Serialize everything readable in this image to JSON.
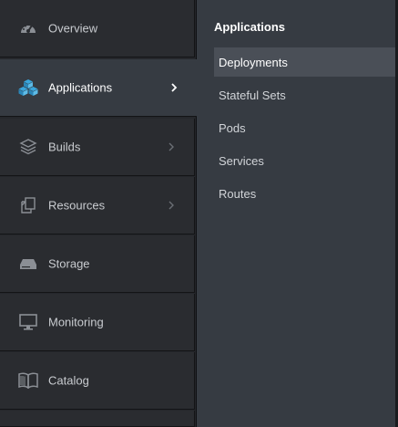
{
  "nav": {
    "items": [
      {
        "label": "Overview",
        "icon": "dashboard-gauge-icon",
        "has_submenu": false
      },
      {
        "label": "Applications",
        "icon": "cubes-icon",
        "has_submenu": true,
        "active": true
      },
      {
        "label": "Builds",
        "icon": "layers-icon",
        "has_submenu": true
      },
      {
        "label": "Resources",
        "icon": "files-icon",
        "has_submenu": true
      },
      {
        "label": "Storage",
        "icon": "hard-drive-icon",
        "has_submenu": false
      },
      {
        "label": "Monitoring",
        "icon": "monitor-icon",
        "has_submenu": false
      },
      {
        "label": "Catalog",
        "icon": "book-icon",
        "has_submenu": false
      }
    ]
  },
  "submenu": {
    "title": "Applications",
    "items": [
      {
        "label": "Deployments",
        "selected": true
      },
      {
        "label": "Stateful Sets"
      },
      {
        "label": "Pods"
      },
      {
        "label": "Services"
      },
      {
        "label": "Routes"
      }
    ]
  },
  "colors": {
    "accent_blue": "#39a5dc",
    "sidebar_bg": "#2a2c30",
    "active_bg": "#363b42",
    "selected_bg": "#4a4f57"
  }
}
